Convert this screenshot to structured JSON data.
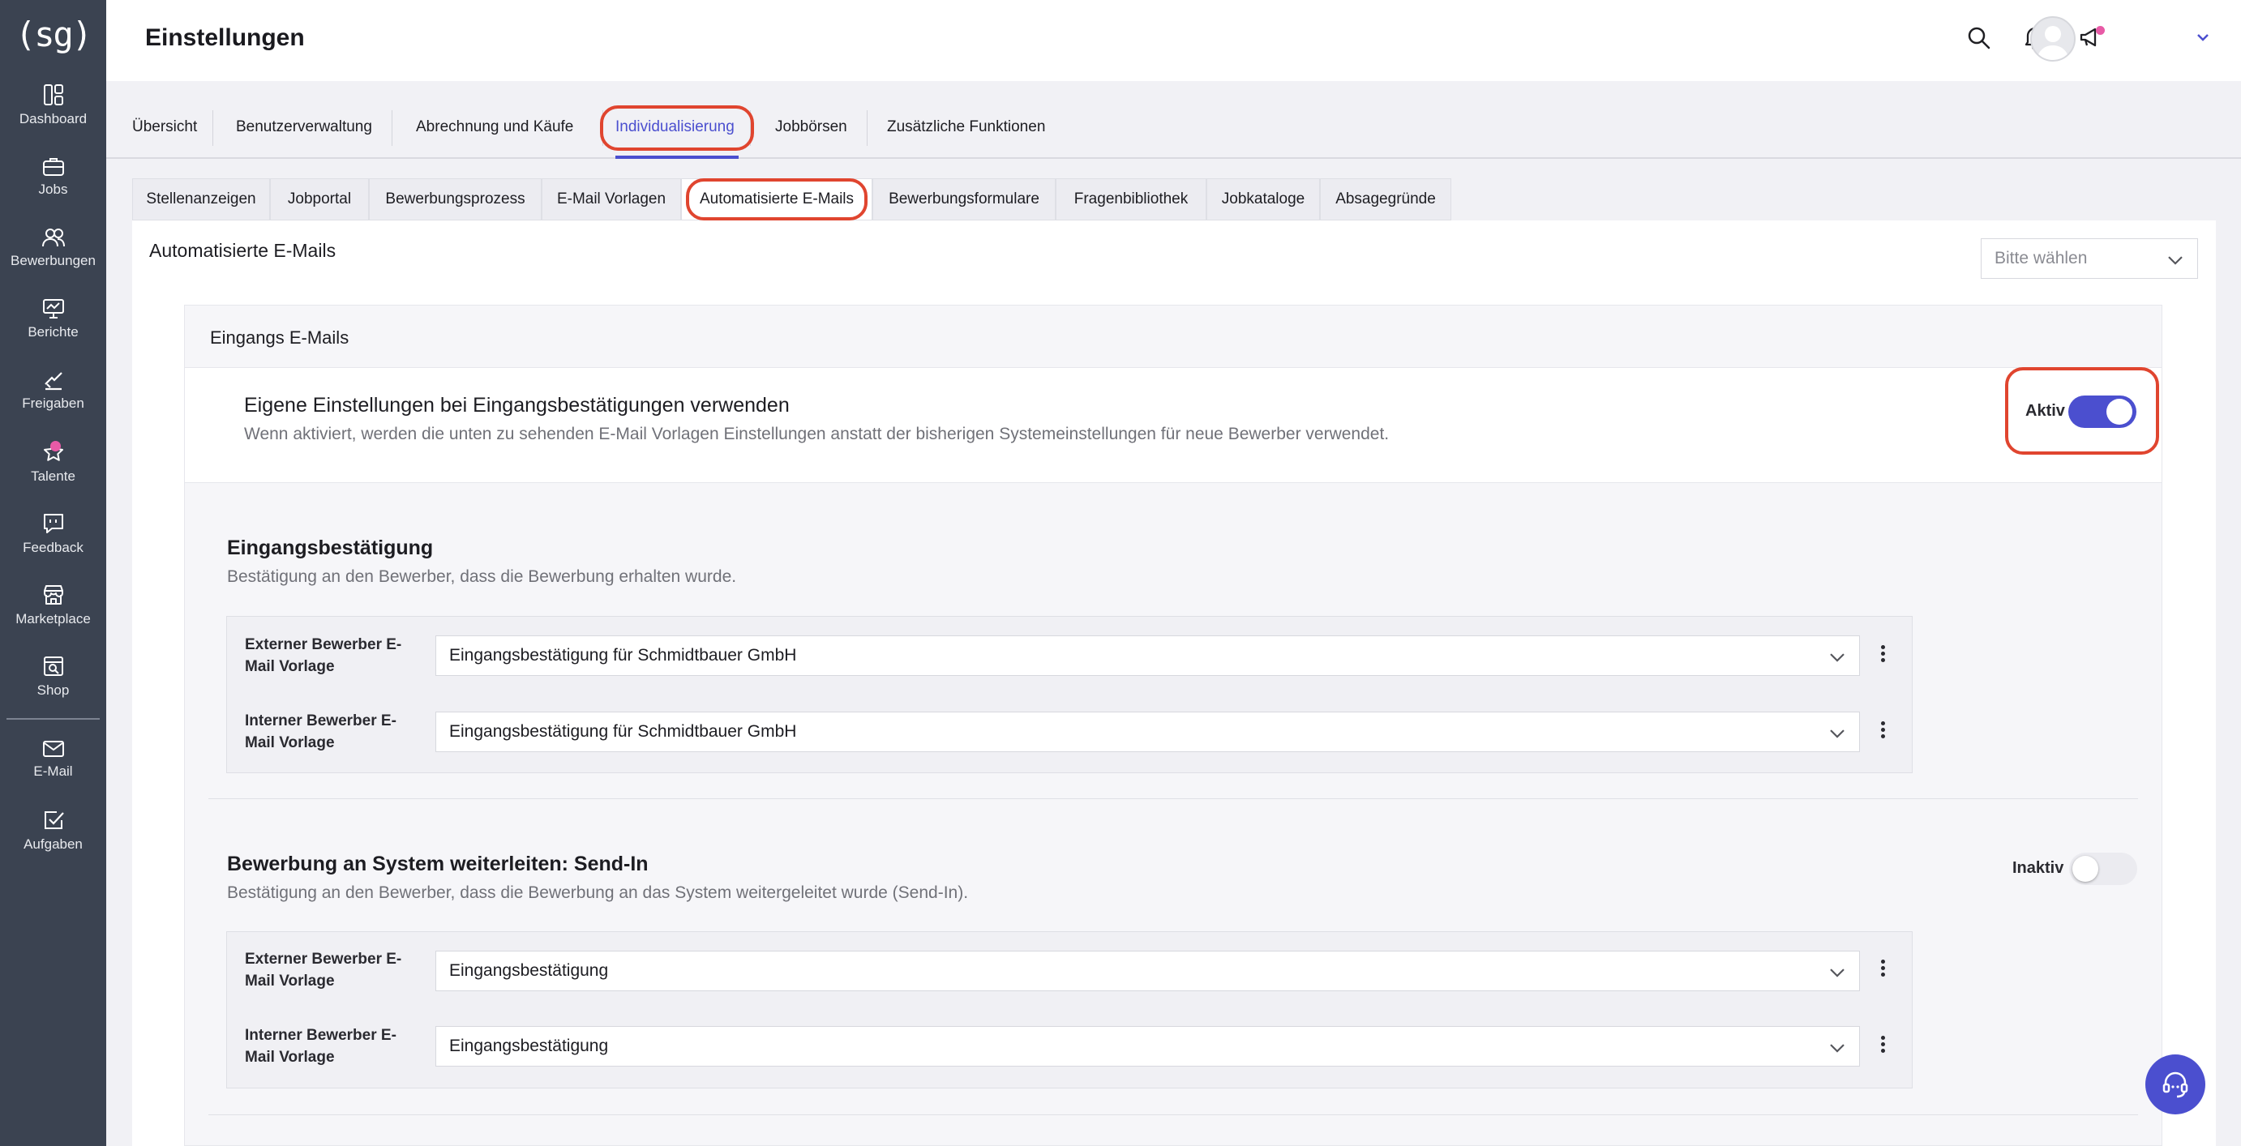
{
  "app": {
    "logo": "(sg)",
    "page_title": "Einstellungen"
  },
  "sidebar": {
    "items": [
      {
        "label": "Dashboard",
        "icon": "dashboard-icon"
      },
      {
        "label": "Jobs",
        "icon": "briefcase-icon"
      },
      {
        "label": "Bewerbungen",
        "icon": "users-icon"
      },
      {
        "label": "Berichte",
        "icon": "chart-board-icon"
      },
      {
        "label": "Freigaben",
        "icon": "approval-hand-icon"
      },
      {
        "label": "Talente",
        "icon": "star-icon"
      },
      {
        "label": "Feedback",
        "icon": "feedback-bubble-icon"
      },
      {
        "label": "Marketplace",
        "icon": "store-icon"
      },
      {
        "label": "Shop",
        "icon": "shop-search-icon"
      },
      {
        "label": "E-Mail",
        "icon": "mail-icon"
      },
      {
        "label": "Aufgaben",
        "icon": "task-check-icon"
      }
    ]
  },
  "main_tabs": [
    {
      "label": "Übersicht"
    },
    {
      "label": "Benutzerverwaltung"
    },
    {
      "label": "Abrechnung und Käufe"
    },
    {
      "label": "Individualisierung",
      "active": true
    },
    {
      "label": "Jobbörsen"
    },
    {
      "label": "Zusätzliche Funktionen"
    }
  ],
  "sub_tabs": [
    {
      "label": "Stellenanzeigen"
    },
    {
      "label": "Jobportal"
    },
    {
      "label": "Bewerbungsprozess"
    },
    {
      "label": "E-Mail Vorlagen"
    },
    {
      "label": "Automatisierte E-Mails",
      "active": true
    },
    {
      "label": "Bewerbungsformulare"
    },
    {
      "label": "Fragenbibliothek"
    },
    {
      "label": "Jobkataloge"
    },
    {
      "label": "Absagegründe"
    }
  ],
  "content": {
    "title": "Automatisierte E-Mails",
    "filter_placeholder": "Bitte wählen",
    "group_label": "Eingangs E-Mails",
    "custom_settings": {
      "title": "Eigene Einstellungen bei Eingangsbestätigungen verwenden",
      "description": "Wenn aktiviert, werden die unten zu sehenden E-Mail Vorlagen Einstellungen anstatt der bisherigen Systemeinstellungen für neue Bewerber verwendet.",
      "toggle_label": "Aktiv",
      "toggle_on": true
    },
    "sections": [
      {
        "title": "Eingangsbestätigung",
        "description": "Bestätigung an den Bewerber, dass die Bewerbung erhalten wurde.",
        "rows": [
          {
            "label_line1": "Externer Bewerber E-",
            "label_line2": "Mail Vorlage",
            "value": "Eingangsbestätigung für Schmidtbauer GmbH"
          },
          {
            "label_line1": "Interner Bewerber E-",
            "label_line2": "Mail Vorlage",
            "value": "Eingangsbestätigung für Schmidtbauer GmbH"
          }
        ]
      },
      {
        "title": "Bewerbung an System weiterleiten: Send-In",
        "description": "Bestätigung an den Bewerber, dass die Bewerbung an das System weitergeleitet wurde (Send-In).",
        "toggle_label": "Inaktiv",
        "toggle_on": false,
        "rows": [
          {
            "label_line1": "Externer Bewerber E-",
            "label_line2": "Mail Vorlage",
            "value": "Eingangsbestätigung"
          },
          {
            "label_line1": "Interner Bewerber E-",
            "label_line2": "Mail Vorlage",
            "value": "Eingangsbestätigung"
          }
        ]
      }
    ]
  },
  "colors": {
    "accent": "#4b4fcf",
    "sidebar": "#3b4351",
    "highlight": "#e0452f",
    "badge": "#e85aa6"
  }
}
